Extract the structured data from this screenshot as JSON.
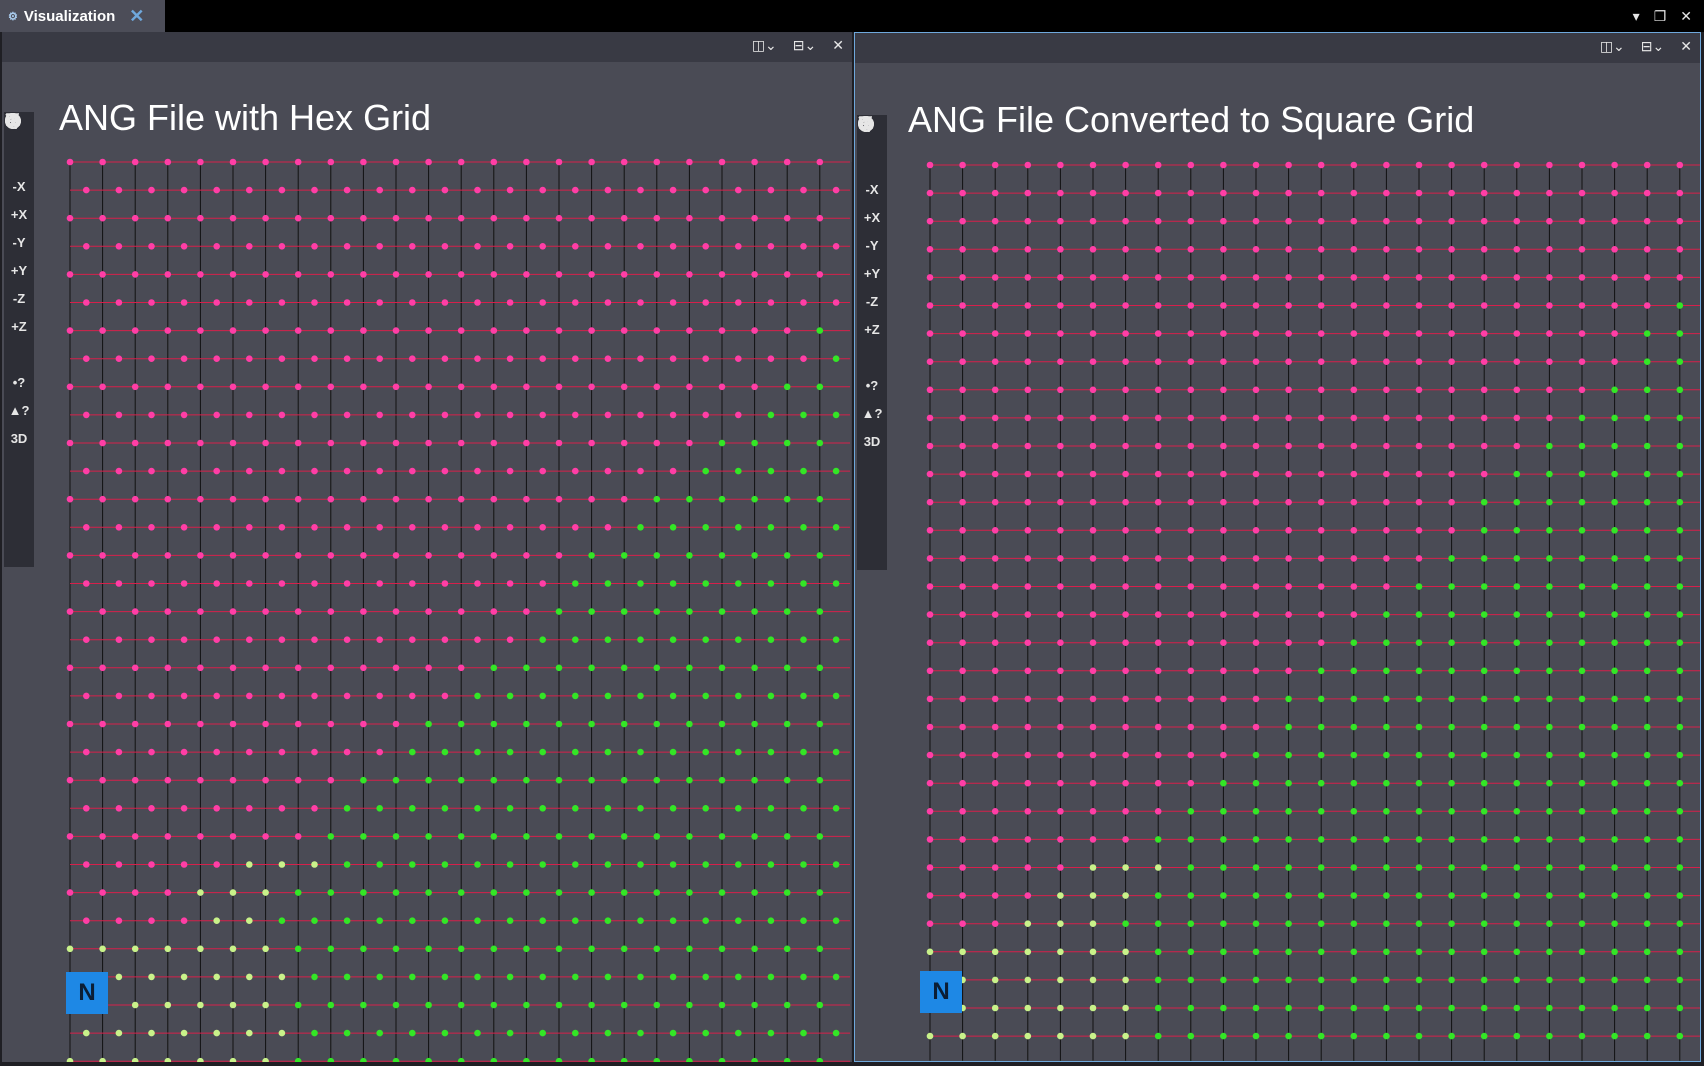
{
  "app": {
    "tab": {
      "label": "Visualization",
      "icon": "visualization-icon",
      "close_icon": "close-icon"
    },
    "window_controls": [
      "chevron-down-icon",
      "restore-icon",
      "close-icon"
    ]
  },
  "colors": {
    "accent": "#6fa8dc",
    "triad_bg": "#1e88e5",
    "plot_bg": "#4a4b55",
    "row_line": "#d6204b",
    "column_line": "#111111",
    "phase_a": "#ff3ea6",
    "phase_b": "#33e626",
    "phase_boundary": "#c9f28a"
  },
  "panels": [
    {
      "id": "left",
      "title": "ANG File with Hex Grid",
      "header_buttons": [
        "split-horizontal-icon",
        "split-vertical-icon",
        "close-icon"
      ],
      "toolbar": [
        {
          "name": "dropdown",
          "label": "",
          "icon": "chevron-down-icon"
        },
        {
          "name": "camera",
          "label": "",
          "icon": "camera-icon"
        },
        {
          "name": "neg-x",
          "label": "-X"
        },
        {
          "name": "pos-x",
          "label": "+X"
        },
        {
          "name": "neg-y",
          "label": "-Y"
        },
        {
          "name": "pos-y",
          "label": "+Y"
        },
        {
          "name": "neg-z",
          "label": "-Z"
        },
        {
          "name": "pos-z",
          "label": "+Z"
        },
        {
          "name": "z-up",
          "label": "",
          "icon": "z-axis-icon"
        },
        {
          "name": "vertex-query",
          "label": "•?"
        },
        {
          "name": "face-query",
          "label": "▲?"
        },
        {
          "name": "3d-2d",
          "label": "3D"
        },
        {
          "name": "rotate",
          "label": "",
          "icon": "rotate-icon"
        },
        {
          "name": "zoom",
          "label": "",
          "icon": "zoom-icon"
        },
        {
          "name": "select",
          "label": "",
          "icon": "select-icon"
        }
      ],
      "grid_type": "hex",
      "triad": {
        "label": "N",
        "icon": "axis-triad-icon"
      }
    },
    {
      "id": "right",
      "title": "ANG File Converted to Square Grid",
      "header_buttons": [
        "split-horizontal-icon",
        "split-vertical-icon",
        "close-icon"
      ],
      "toolbar": [
        {
          "name": "dropdown",
          "label": "",
          "icon": "chevron-down-icon"
        },
        {
          "name": "camera",
          "label": "",
          "icon": "camera-icon"
        },
        {
          "name": "neg-x",
          "label": "-X"
        },
        {
          "name": "pos-x",
          "label": "+X"
        },
        {
          "name": "neg-y",
          "label": "-Y"
        },
        {
          "name": "pos-y",
          "label": "+Y"
        },
        {
          "name": "neg-z",
          "label": "-Z"
        },
        {
          "name": "pos-z",
          "label": "+Z"
        },
        {
          "name": "z-up",
          "label": "",
          "icon": "z-axis-icon"
        },
        {
          "name": "vertex-query",
          "label": "•?"
        },
        {
          "name": "face-query",
          "label": "▲?"
        },
        {
          "name": "3d-2d",
          "label": "3D"
        },
        {
          "name": "rotate",
          "label": "",
          "icon": "rotate-icon"
        },
        {
          "name": "zoom",
          "label": "",
          "icon": "zoom-icon"
        },
        {
          "name": "select",
          "label": "",
          "icon": "select-icon"
        }
      ],
      "grid_type": "square",
      "triad": {
        "label": "N",
        "icon": "axis-triad-icon"
      }
    }
  ]
}
